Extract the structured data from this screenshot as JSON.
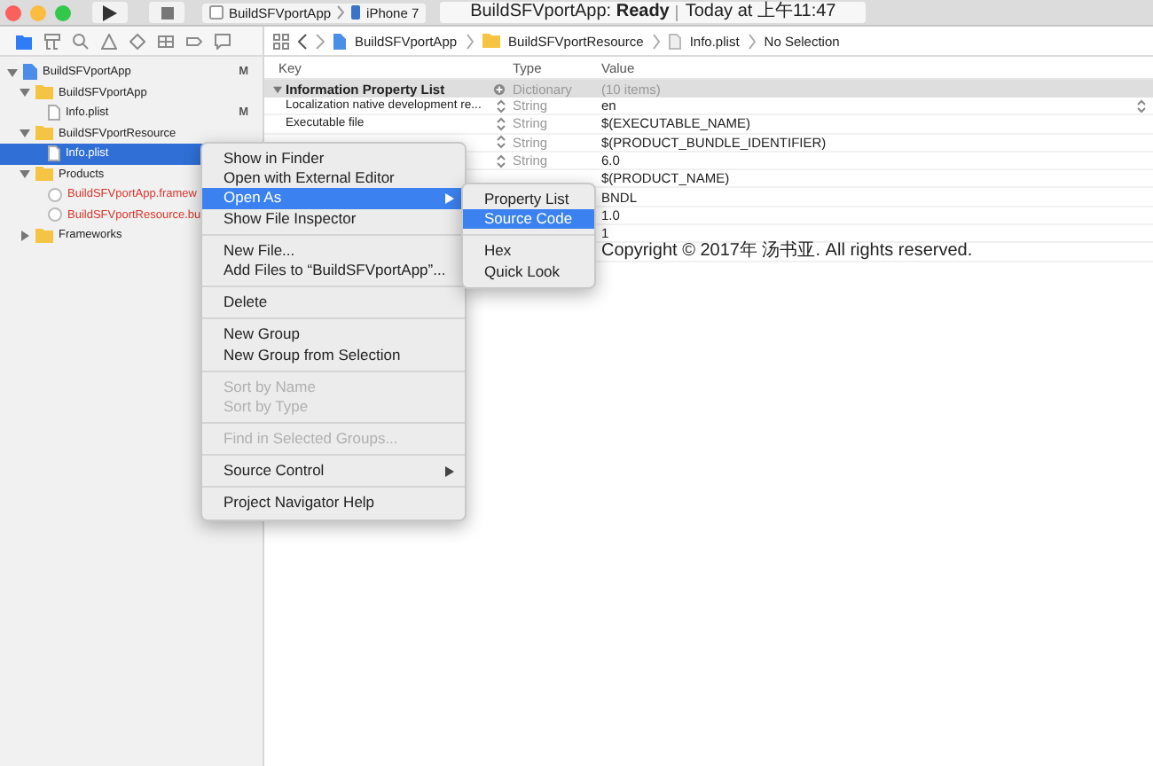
{
  "toolbar": {
    "scheme": {
      "target": "BuildSFVportApp",
      "device": "iPhone 7"
    },
    "status": {
      "project": "BuildSFVportApp:",
      "state": "Ready",
      "time": "Today at 上午11:47"
    }
  },
  "navigator_tabs": [
    {
      "kind": "folder",
      "selected": true
    },
    {
      "kind": "hierarchy",
      "selected": false
    },
    {
      "kind": "search",
      "selected": false
    },
    {
      "kind": "warning",
      "selected": false
    },
    {
      "kind": "diamond",
      "selected": false
    },
    {
      "kind": "grid",
      "selected": false
    },
    {
      "kind": "tag",
      "selected": false
    },
    {
      "kind": "bubble",
      "selected": false
    }
  ],
  "sidebar": {
    "items": [
      {
        "kind": "project",
        "label": "BuildSFVportApp",
        "badge": "M",
        "expanded": true,
        "selected": false,
        "missing": false,
        "children": [
          {
            "kind": "folder",
            "label": "BuildSFVportApp",
            "expanded": true,
            "selected": false,
            "missing": false,
            "children": [
              {
                "kind": "file",
                "label": "Info.plist",
                "badge": "M",
                "selected": false,
                "missing": false
              }
            ]
          },
          {
            "kind": "folder",
            "label": "BuildSFVportResource",
            "expanded": true,
            "selected": false,
            "missing": false,
            "children": [
              {
                "kind": "file",
                "label": "Info.plist",
                "selected": true,
                "missing": false
              }
            ]
          },
          {
            "kind": "folder",
            "label": "Products",
            "expanded": true,
            "selected": false,
            "missing": false,
            "children": [
              {
                "kind": "product",
                "label": "BuildSFVportApp.framew",
                "selected": false,
                "missing": true
              },
              {
                "kind": "product",
                "label": "BuildSFVportResource.bu",
                "selected": false,
                "missing": true
              }
            ]
          },
          {
            "kind": "folder",
            "label": "Frameworks",
            "expanded": false,
            "selected": false,
            "missing": false
          }
        ]
      }
    ]
  },
  "jump_bar": [
    {
      "kind": "project",
      "label": "BuildSFVportApp"
    },
    {
      "kind": "folder",
      "label": "BuildSFVportResource"
    },
    {
      "kind": "file",
      "label": "Info.plist"
    },
    {
      "kind": "text",
      "label": "No Selection"
    }
  ],
  "table": {
    "columns": [
      "Key",
      "Type",
      "Value"
    ],
    "root": {
      "key": "Information Property List",
      "type": "Dictionary",
      "value": "(10 items)",
      "expanded": true
    },
    "rows": [
      {
        "key": "Localization native development re...",
        "type": "String",
        "value": "en"
      },
      {
        "key": "Executable file",
        "type": "String",
        "value": "$(EXECUTABLE_NAME)"
      },
      {
        "type": "String",
        "value": "$(PRODUCT_BUNDLE_IDENTIFIER)"
      },
      {
        "type": "String",
        "value": "6.0"
      },
      {
        "value": "$(PRODUCT_NAME)"
      },
      {
        "value": "BNDL"
      },
      {
        "value": "1.0"
      },
      {
        "value": "1"
      },
      {
        "value": "Copyright © 2017年 汤书亚. All rights reserved."
      }
    ]
  },
  "context_menu": {
    "items": [
      {
        "kind": "item",
        "label": "Show in Finder",
        "disabled": false,
        "selected": false,
        "has_submenu": false
      },
      {
        "kind": "item",
        "label": "Open with External Editor",
        "disabled": false,
        "selected": false,
        "has_submenu": false
      },
      {
        "kind": "item",
        "label": "Open As",
        "disabled": false,
        "selected": true,
        "has_submenu": true
      },
      {
        "kind": "item",
        "label": "Show File Inspector",
        "disabled": false,
        "selected": false,
        "has_submenu": false
      },
      {
        "kind": "separator"
      },
      {
        "kind": "item",
        "label": "New File...",
        "disabled": false,
        "selected": false,
        "has_submenu": false
      },
      {
        "kind": "item",
        "label": "Add Files to “BuildSFVportApp”...",
        "disabled": false,
        "selected": false,
        "has_submenu": false
      },
      {
        "kind": "separator"
      },
      {
        "kind": "item",
        "label": "Delete",
        "disabled": false,
        "selected": false,
        "has_submenu": false
      },
      {
        "kind": "separator"
      },
      {
        "kind": "item",
        "label": "New Group",
        "disabled": false,
        "selected": false,
        "has_submenu": false
      },
      {
        "kind": "item",
        "label": "New Group from Selection",
        "disabled": false,
        "selected": false,
        "has_submenu": false
      },
      {
        "kind": "separator"
      },
      {
        "kind": "item",
        "label": "Sort by Name",
        "disabled": true,
        "selected": false,
        "has_submenu": false
      },
      {
        "kind": "item",
        "label": "Sort by Type",
        "disabled": true,
        "selected": false,
        "has_submenu": false
      },
      {
        "kind": "separator"
      },
      {
        "kind": "item",
        "label": "Find in Selected Groups...",
        "disabled": true,
        "selected": false,
        "has_submenu": false
      },
      {
        "kind": "separator"
      },
      {
        "kind": "item",
        "label": "Source Control",
        "disabled": false,
        "selected": false,
        "has_submenu": true
      },
      {
        "kind": "separator"
      },
      {
        "kind": "item",
        "label": "Project Navigator Help",
        "disabled": false,
        "selected": false,
        "has_submenu": false
      }
    ]
  },
  "submenu": {
    "items": [
      {
        "kind": "item",
        "label": "Property List",
        "selected": false
      },
      {
        "kind": "item",
        "label": "Source Code",
        "selected": true
      },
      {
        "kind": "separator"
      },
      {
        "kind": "item",
        "label": "Hex",
        "selected": false
      },
      {
        "kind": "item",
        "label": "Quick Look",
        "selected": false
      }
    ]
  }
}
